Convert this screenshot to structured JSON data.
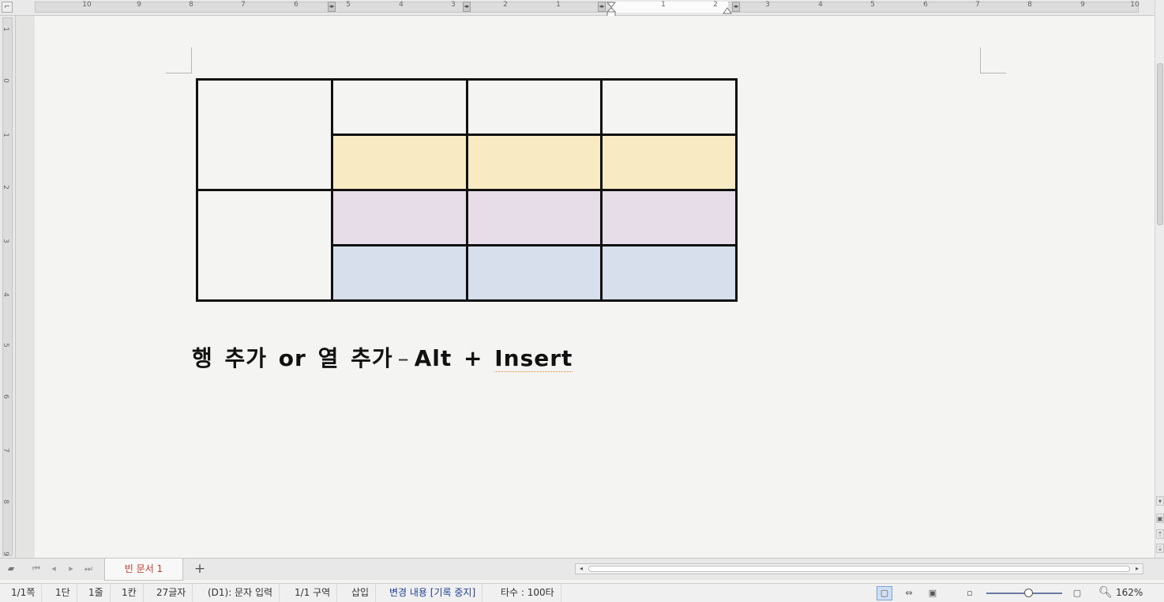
{
  "ruler": {
    "horizontal_left_labels": [
      "10",
      "9",
      "8",
      "7",
      "6",
      "5",
      "4",
      "3",
      "2",
      "1"
    ],
    "horizontal_right_labels": [
      "1",
      "2",
      "3",
      "4",
      "5",
      "6",
      "7",
      "8",
      "9",
      "10"
    ],
    "vertical_labels": [
      "1",
      "0",
      "1",
      "2",
      "3",
      "4",
      "5",
      "6",
      "7",
      "8",
      "9"
    ]
  },
  "document": {
    "table": {
      "rows": 4,
      "columns": 4,
      "row_colors": [
        "#f4f4f2",
        "#f8eac3",
        "#e7dde8",
        "#d7dfec"
      ]
    },
    "shortcut_text": {
      "part1": "행 추가 or 열 추가",
      "dash": "–",
      "part2": "Alt + ",
      "part3": "Insert"
    }
  },
  "tabs": {
    "active_tab_label": "빈 문서 1",
    "add_tab_label": "+"
  },
  "status_bar": {
    "page": "1/1쪽",
    "column": "1단",
    "line": "1줄",
    "cell": "1칸",
    "chars": "27글자",
    "mode": "(D1): 문자 입력",
    "section": "1/1 구역",
    "insert_mode": "삽입",
    "track_changes": "변경 내용 [기록 중지]",
    "typing_speed": "타수 : 100타",
    "zoom": "162%"
  },
  "colors": {
    "table_border": "#111111",
    "track_changes_text": "#1f3f95",
    "active_tab_text": "#c0392b"
  }
}
